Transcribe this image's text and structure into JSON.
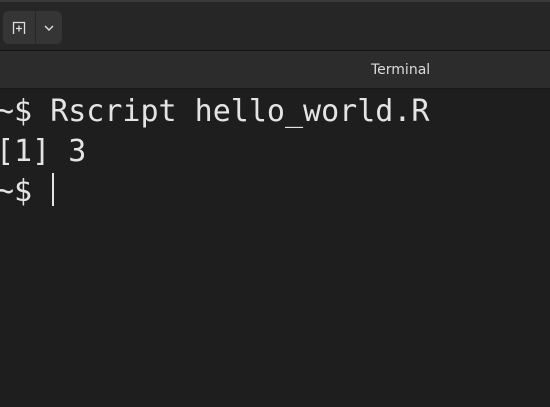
{
  "header": {
    "new_tab_icon": "new-tab-icon",
    "menu_icon": "chevron-down-icon"
  },
  "tabs": [
    {
      "label": "Terminal"
    }
  ],
  "terminal": {
    "lines": [
      {
        "prompt": "~$ ",
        "text": "Rscript hello_world.R"
      },
      {
        "prompt": "",
        "text": "[1] 3"
      },
      {
        "prompt": "~$ ",
        "text": ""
      }
    ]
  },
  "colors": {
    "background": "#1e1e1e",
    "header": "#262626",
    "tab_strip": "#2c2c2c",
    "text": "#e4e4e4"
  }
}
